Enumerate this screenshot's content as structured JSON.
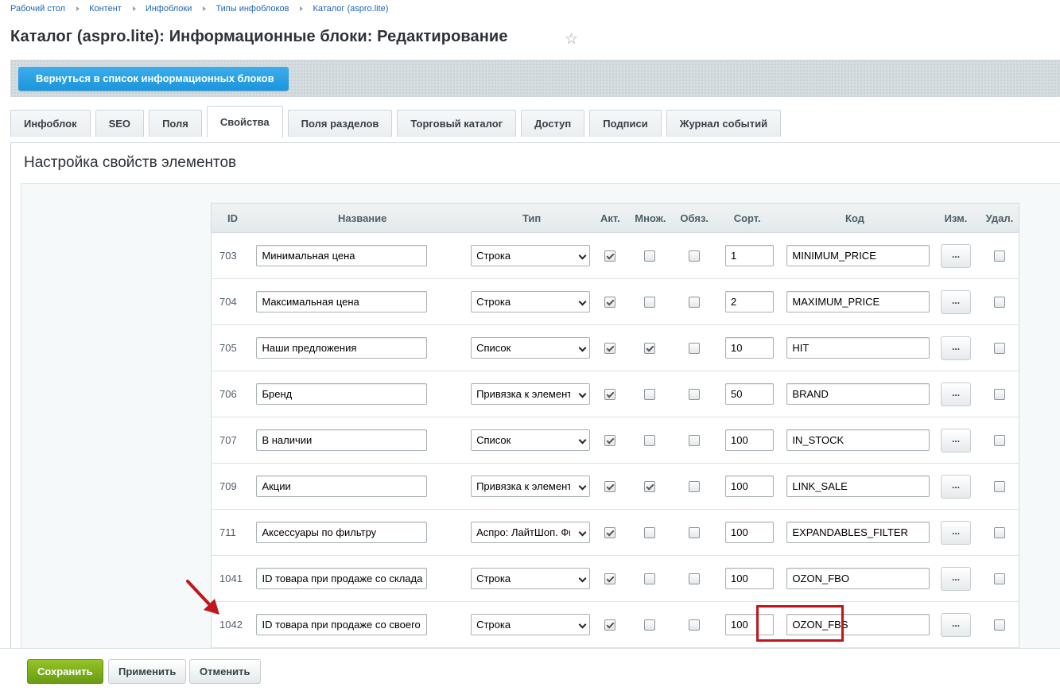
{
  "breadcrumbs": [
    "Рабочий стол",
    "Контент",
    "Инфоблоки",
    "Типы инфоблоков",
    "Каталог (aspro.lite)"
  ],
  "title": "Каталог (aspro.lite): Информационные блоки: Редактирование",
  "back_button": "Вернуться в список информационных блоков",
  "tabs": [
    "Инфоблок",
    "SEO",
    "Поля",
    "Свойства",
    "Поля разделов",
    "Торговый каталог",
    "Доступ",
    "Подписи",
    "Журнал событий"
  ],
  "active_tab": "Свойства",
  "section_title": "Настройка свойств элементов",
  "columns": {
    "id": "ID",
    "name": "Название",
    "type": "Тип",
    "active": "Акт.",
    "multiple": "Множ.",
    "required": "Обяз.",
    "sort": "Сорт.",
    "code": "Код",
    "edit": "Изм.",
    "delete": "Удал."
  },
  "edit_label": "...",
  "rows": [
    {
      "id": "703",
      "name": "Минимальная цена",
      "type": "Строка",
      "active": true,
      "multiple": false,
      "required": false,
      "sort": "1",
      "code": "MINIMUM_PRICE"
    },
    {
      "id": "704",
      "name": "Максимальная цена",
      "type": "Строка",
      "active": true,
      "multiple": false,
      "required": false,
      "sort": "2",
      "code": "MAXIMUM_PRICE"
    },
    {
      "id": "705",
      "name": "Наши предложения",
      "type": "Список",
      "active": true,
      "multiple": true,
      "required": false,
      "sort": "10",
      "code": "HIT"
    },
    {
      "id": "706",
      "name": "Бренд",
      "type": "Привязка к элементам",
      "active": true,
      "multiple": false,
      "required": false,
      "sort": "50",
      "code": "BRAND"
    },
    {
      "id": "707",
      "name": "В наличии",
      "type": "Список",
      "active": true,
      "multiple": false,
      "required": false,
      "sort": "100",
      "code": "IN_STOCK"
    },
    {
      "id": "709",
      "name": "Акции",
      "type": "Привязка к элементам",
      "active": true,
      "multiple": true,
      "required": false,
      "sort": "100",
      "code": "LINK_SALE"
    },
    {
      "id": "711",
      "name": "Аксессуары по фильтру",
      "type": "Аспро: ЛайтШоп. Фильтр",
      "active": true,
      "multiple": false,
      "required": false,
      "sort": "100",
      "code": "EXPANDABLES_FILTER"
    },
    {
      "id": "1041",
      "name": "ID товара при продаже со склада",
      "type": "Строка",
      "active": true,
      "multiple": false,
      "required": false,
      "sort": "100",
      "code": "OZON_FBO"
    },
    {
      "id": "1042",
      "name": "ID товара при продаже со своего",
      "type": "Строка",
      "active": true,
      "multiple": false,
      "required": false,
      "sort": "100",
      "code": "OZON_FBS"
    }
  ],
  "buttons": {
    "save": "Сохранить",
    "apply": "Применить",
    "cancel": "Отменить"
  },
  "colors": {
    "accent": "#2067b0",
    "save": "#7cac1c",
    "highlight": "#c0161c"
  }
}
